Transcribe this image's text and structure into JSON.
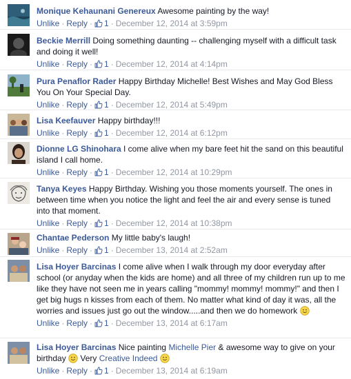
{
  "actions": {
    "unlike_label": "Unlike",
    "reply_label": "Reply",
    "separator": "·"
  },
  "comments": [
    {
      "author": "Monique Kehaunani Genereux",
      "text": "Awesome painting by the way!",
      "likes": "1",
      "timestamp": "December 12, 2014 at 3:59pm",
      "avatar": "ocean-avatar"
    },
    {
      "author": "Beckie Merrill",
      "text": "Doing something daunting -- challenging myself with a difficult task and doing it well!",
      "likes": "1",
      "timestamp": "December 12, 2014 at 4:14pm",
      "avatar": "dark-avatar"
    },
    {
      "author": "Pura Penaflor Rader",
      "text": "Happy Birthday Michelle! Best Wishes and May God Bless You On Your Special Day.",
      "likes": "1",
      "timestamp": "December 12, 2014 at 5:49pm",
      "avatar": "landscape-avatar"
    },
    {
      "author": "Lisa Keefauver",
      "text": "Happy birthday!!!",
      "likes": "1",
      "timestamp": "December 12, 2014 at 6:12pm",
      "avatar": "group-avatar"
    },
    {
      "author": "Dionne LG Shinohara",
      "text": "I come alive when my bare feet hit the sand on this beautiful island I call home.",
      "likes": "1",
      "timestamp": "December 12, 2014 at 10:29pm",
      "avatar": "portrait-avatar"
    },
    {
      "author": "Tanya Keyes",
      "text": "Happy Birthday. Wishing you those moments yourself. The ones in between time when you notice the light and feel the air and every sense is tuned into that moment.",
      "likes": "1",
      "timestamp": "December 12, 2014 at 10:38pm",
      "avatar": "sketch-avatar"
    },
    {
      "author": "Chantae Pederson",
      "text": "My little baby's laugh!",
      "likes": "1",
      "timestamp": "December 13, 2014 at 2:52am",
      "avatar": "family-avatar"
    },
    {
      "author": "Lisa Hoyer Barcinas",
      "text": "I come alive when I walk through my door everyday after school (or anyday when the kids are home) and all three of my children run up to me like they have not seen me in years calling \"mommy! mommy! mommy!\" and then I get big hugs n kisses from each of them. No matter what kind of day it was, all the worries and issues just go out the window.....and then we do homework",
      "likes": "1",
      "timestamp": "December 13, 2014 at 6:17am",
      "avatar": "kids-avatar"
    },
    {
      "author": "Lisa Hoyer Barcinas",
      "text_part1": "Nice painting",
      "mention": "Michelle Pier",
      "text_part2": "& awesome way to give on your birthday",
      "text_part3": "Very",
      "link_text": "Creative Indeed",
      "likes": "1",
      "timestamp": "December 13, 2014 at 6:19am",
      "avatar": "kids-avatar"
    }
  ],
  "colors": {
    "link": "#3b5998",
    "meta": "#9197a3",
    "text": "#141823"
  }
}
